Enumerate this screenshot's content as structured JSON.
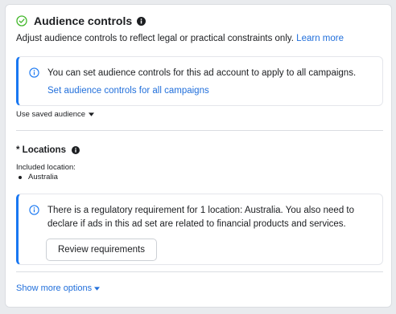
{
  "header": {
    "title": "Audience controls",
    "description": "Adjust audience controls to reflect legal or practical constraints only.",
    "learn_more": "Learn more"
  },
  "account_notice": {
    "text": "You can set audience controls for this ad account to apply to all campaigns.",
    "link": "Set audience controls for all campaigns"
  },
  "saved_audience": {
    "label": "Use saved audience"
  },
  "locations": {
    "title": "* Locations",
    "included_label": "Included location:",
    "items": [
      "Australia"
    ]
  },
  "regulatory_notice": {
    "text": "There is a regulatory requirement for 1 location: Australia. You also need to declare if ads in this ad set are related to financial products and services.",
    "button": "Review requirements"
  },
  "footer": {
    "show_more": "Show more options"
  },
  "colors": {
    "accent": "#1877f2",
    "link": "#216fdb",
    "success": "#42b72a",
    "text": "#1c1e21",
    "border": "#dadde1"
  },
  "icons": {
    "header_status": "check-circle-icon",
    "header_info": "info-solid-icon",
    "notice": "info-outline-icon",
    "dropdown": "caret-down-icon"
  }
}
